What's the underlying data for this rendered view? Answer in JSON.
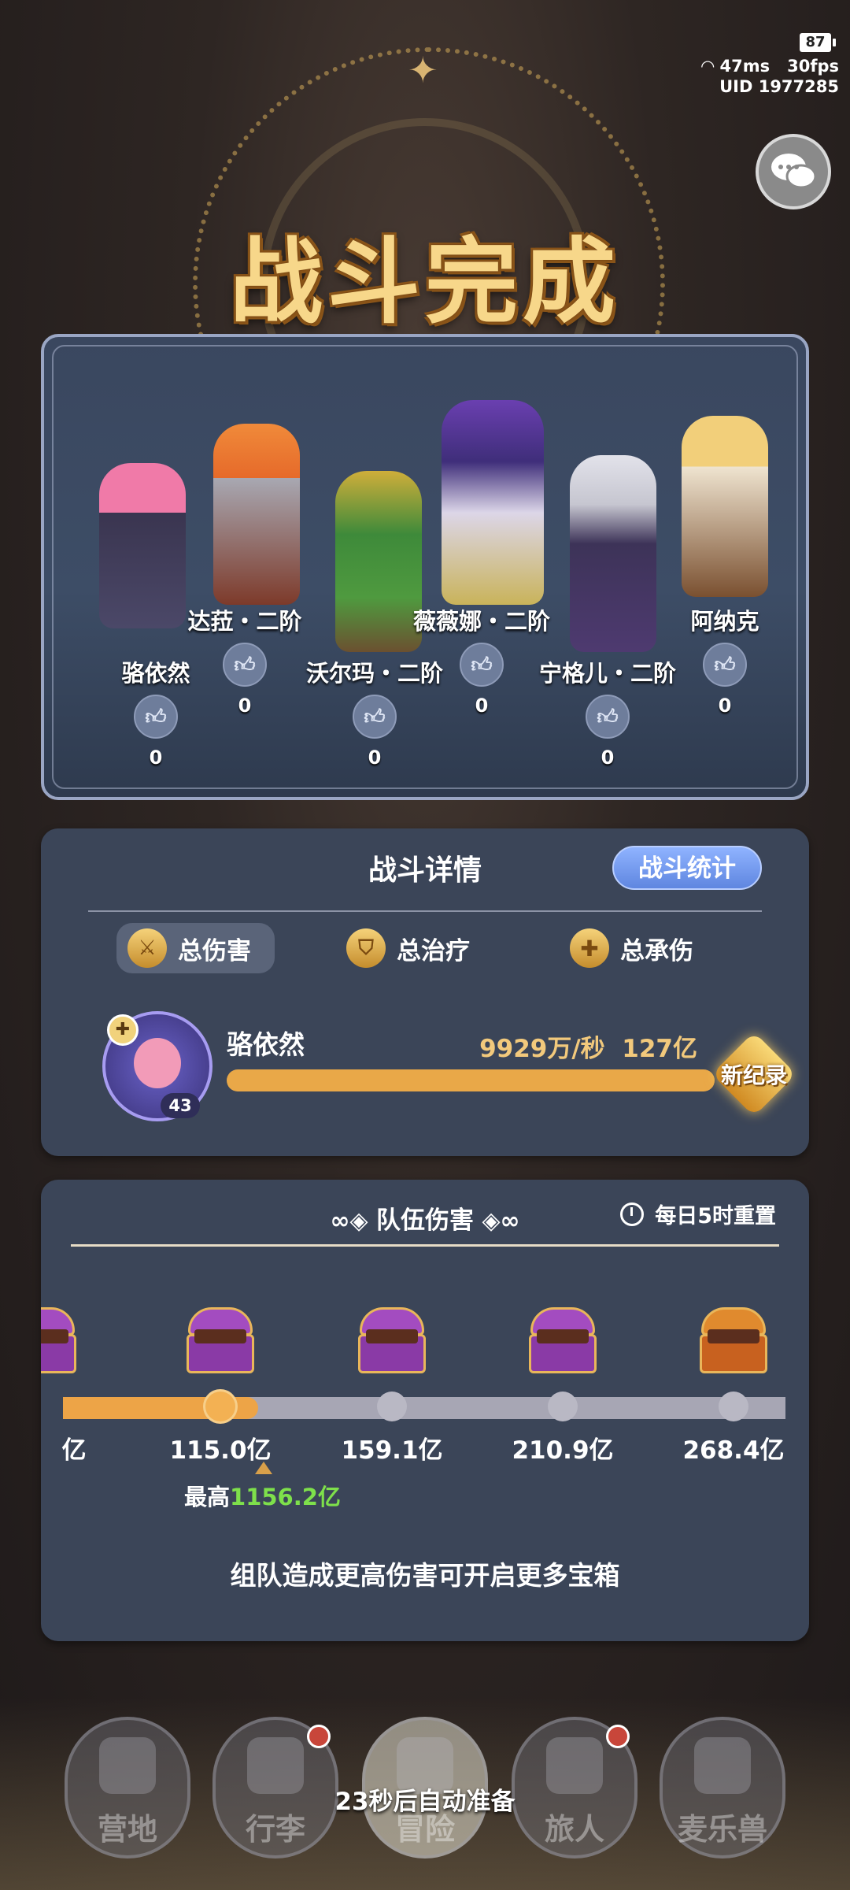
{
  "status": {
    "battery": "87",
    "ping": "47ms",
    "fps": "30fps",
    "uid": "UID 1977285"
  },
  "title": "战斗完成",
  "heroes": [
    {
      "name": "骆依然",
      "likes": "0"
    },
    {
      "name": "达菈・二阶",
      "likes": "0"
    },
    {
      "name": "沃尔玛・二阶",
      "likes": "0"
    },
    {
      "name": "薇薇娜・二阶",
      "likes": "0"
    },
    {
      "name": "宁格儿・二阶",
      "likes": "0"
    },
    {
      "name": "阿纳克",
      "likes": "0"
    }
  ],
  "details": {
    "title": "战斗详情",
    "stats_button": "战斗统计",
    "tabs": [
      "总伤害",
      "总治疗",
      "总承伤"
    ],
    "active_tab": "总伤害",
    "player": {
      "name": "骆依然",
      "level": "43",
      "dps": "9929万/秒",
      "total": "127亿",
      "badge": "新纪录"
    },
    "bar_fill": 1.0
  },
  "team": {
    "title": "队伍伤害",
    "reset": "每日5时重置",
    "thresholds": [
      "亿",
      "115.0亿",
      "159.1亿",
      "210.9亿",
      "268.4亿"
    ],
    "progress_fraction": 0.27,
    "best_label": "最高",
    "best_value": "1156.2亿",
    "hint": "组队造成更高伤害可开启更多宝箱"
  },
  "nav": [
    "营地",
    "行李",
    "冒险",
    "旅人",
    "麦乐兽"
  ],
  "auto_ready": "23秒后自动准备",
  "colors": {
    "accent": "#eda447",
    "panel": "#3b4558",
    "title": "#f7d78a",
    "highlight": "#7ee04b"
  }
}
